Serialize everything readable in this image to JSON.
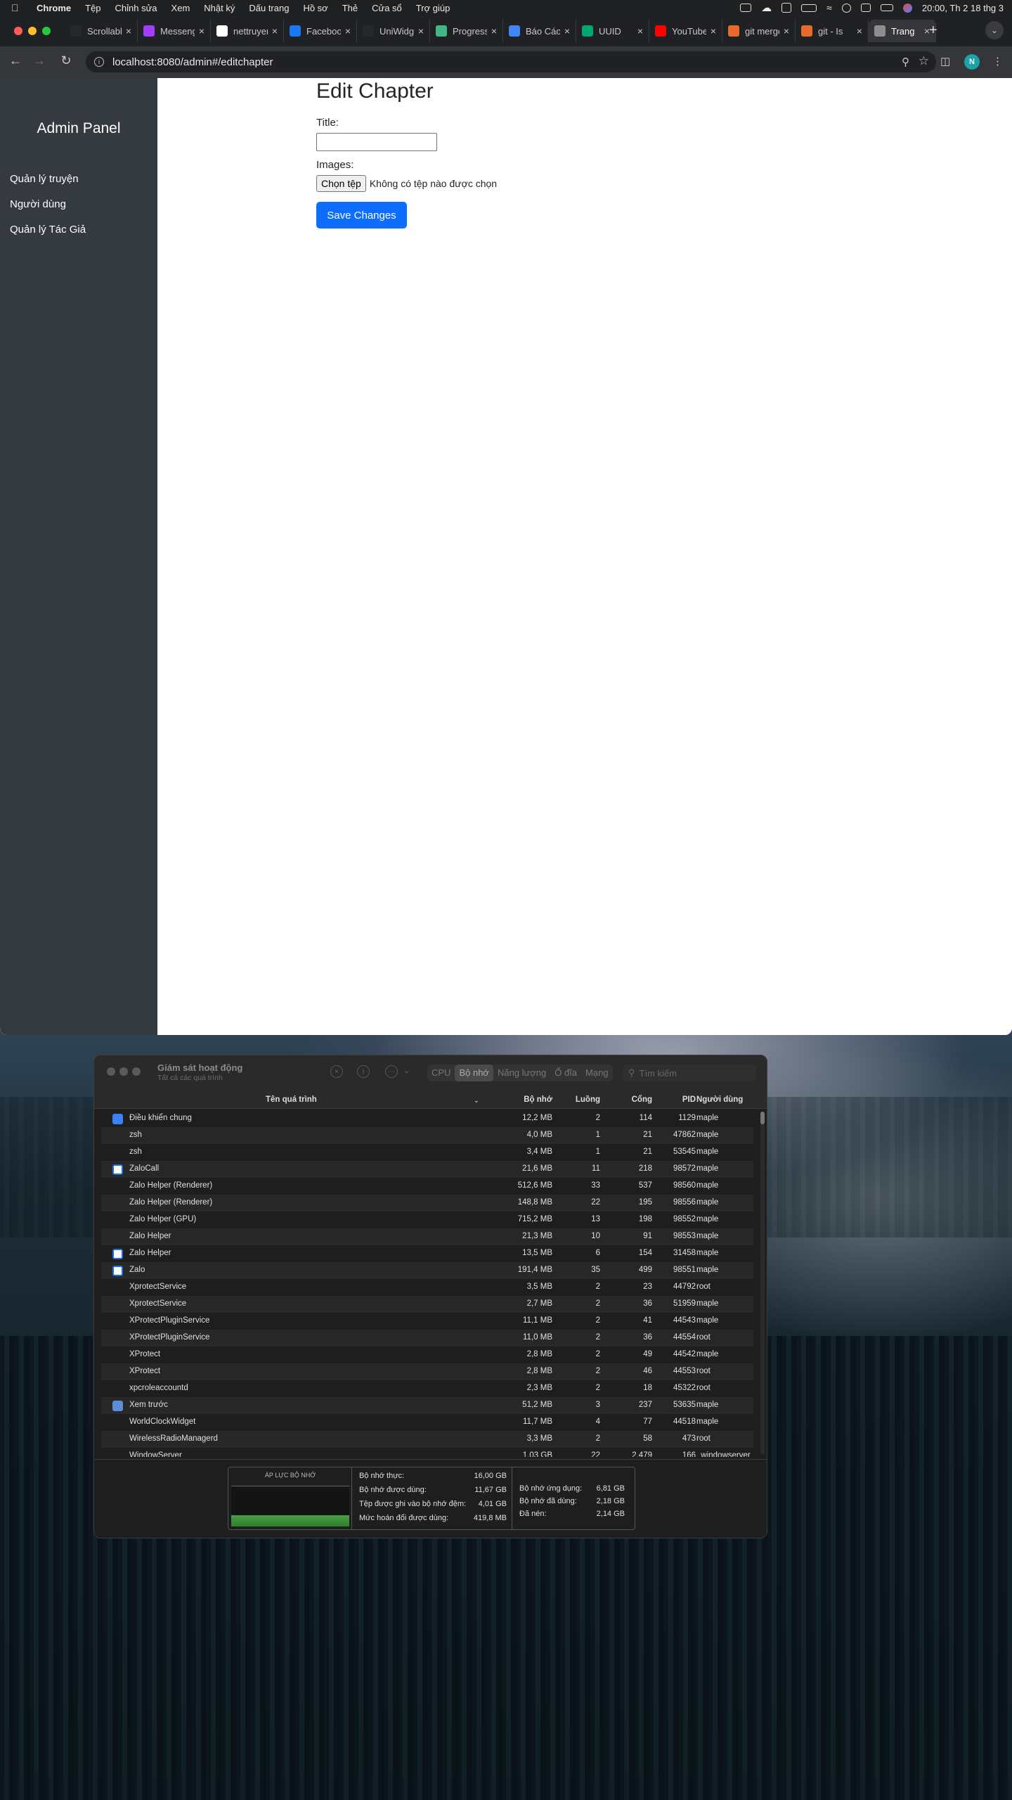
{
  "menubar": {
    "app": "Chrome",
    "items": [
      "Tệp",
      "Chỉnh sửa",
      "Xem",
      "Nhật ký",
      "Dấu trang",
      "Hồ sơ",
      "Thẻ",
      "Cửa sổ",
      "Trợ giúp"
    ],
    "clock": "20:00, Th 2 18 thg 3"
  },
  "browser": {
    "tabs": [
      {
        "label": "Scrollable",
        "icon": "github-icon",
        "color": "#24292e"
      },
      {
        "label": "Messenger",
        "icon": "messenger-icon",
        "color": "#a33dfc"
      },
      {
        "label": "nettruyen",
        "icon": "google-icon",
        "color": "#ffffff"
      },
      {
        "label": "Facebook",
        "icon": "facebook-icon",
        "color": "#1877f2"
      },
      {
        "label": "UniWidget",
        "icon": "github-icon",
        "color": "#24292e"
      },
      {
        "label": "Progress",
        "icon": "vue-icon",
        "color": "#41b883"
      },
      {
        "label": "Báo Cáo",
        "icon": "docs-icon",
        "color": "#4285f4"
      },
      {
        "label": "UUID",
        "icon": "leaf-icon",
        "color": "#00a86b"
      },
      {
        "label": "YouTube",
        "icon": "youtube-icon",
        "color": "#ff0000"
      },
      {
        "label": "git merge",
        "icon": "git-icon",
        "color": "#e56a2c"
      },
      {
        "label": "git - Is",
        "icon": "git-icon",
        "color": "#e56a2c"
      },
      {
        "label": "Trang",
        "icon": "globe-icon",
        "color": "#8e8e8e"
      }
    ],
    "url": "localhost:8080/admin#/editchapter",
    "profile_initial": "N"
  },
  "page": {
    "sidebar": {
      "brand": "Admin Panel",
      "items": [
        "Quản lý truyện",
        "Người dùng",
        "Quản lý Tác Giả"
      ]
    },
    "form": {
      "heading": "Edit Chapter",
      "title_label": "Title:",
      "title_value": "",
      "images_label": "Images:",
      "file_button": "Chọn tệp",
      "file_status": "Không có tệp nào được chọn",
      "save_button": "Save Changes"
    }
  },
  "activity_monitor": {
    "title": "Giám sát hoạt động",
    "subtitle": "Tất cả các quá trình",
    "tabs": [
      "CPU",
      "Bộ nhớ",
      "Năng lượng",
      "Ổ đĩa",
      "Mạng"
    ],
    "selected_tab": "Bộ nhớ",
    "search_placeholder": "Tìm kiếm",
    "columns": [
      "Tên quá trình",
      "Bộ nhớ",
      "Luồng",
      "Cổng",
      "PID",
      "Người dùng"
    ],
    "rows": [
      {
        "name": "Điều khiển chung",
        "mem": "12,2 MB",
        "threads": "2",
        "ports": "114",
        "pid": "1129",
        "user": "maple",
        "icon": "universal-control-icon"
      },
      {
        "name": "zsh",
        "mem": "4,0 MB",
        "threads": "1",
        "ports": "21",
        "pid": "47862",
        "user": "maple",
        "icon": ""
      },
      {
        "name": "zsh",
        "mem": "3,4 MB",
        "threads": "1",
        "ports": "21",
        "pid": "53545",
        "user": "maple",
        "icon": ""
      },
      {
        "name": "ZaloCall",
        "mem": "21,6 MB",
        "threads": "11",
        "ports": "218",
        "pid": "98572",
        "user": "maple",
        "icon": "zalo-icon"
      },
      {
        "name": "Zalo Helper (Renderer)",
        "mem": "512,6 MB",
        "threads": "33",
        "ports": "537",
        "pid": "98560",
        "user": "maple",
        "icon": ""
      },
      {
        "name": "Zalo Helper (Renderer)",
        "mem": "148,8 MB",
        "threads": "22",
        "ports": "195",
        "pid": "98556",
        "user": "maple",
        "icon": ""
      },
      {
        "name": "Zalo Helper (GPU)",
        "mem": "715,2 MB",
        "threads": "13",
        "ports": "198",
        "pid": "98552",
        "user": "maple",
        "icon": ""
      },
      {
        "name": "Zalo Helper",
        "mem": "21,3 MB",
        "threads": "10",
        "ports": "91",
        "pid": "98553",
        "user": "maple",
        "icon": ""
      },
      {
        "name": "Zalo Helper",
        "mem": "13,5 MB",
        "threads": "6",
        "ports": "154",
        "pid": "31458",
        "user": "maple",
        "icon": "zalo-icon"
      },
      {
        "name": "Zalo",
        "mem": "191,4 MB",
        "threads": "35",
        "ports": "499",
        "pid": "98551",
        "user": "maple",
        "icon": "zalo-icon"
      },
      {
        "name": "XprotectService",
        "mem": "3,5 MB",
        "threads": "2",
        "ports": "23",
        "pid": "44792",
        "user": "root",
        "icon": ""
      },
      {
        "name": "XprotectService",
        "mem": "2,7 MB",
        "threads": "2",
        "ports": "36",
        "pid": "51959",
        "user": "maple",
        "icon": ""
      },
      {
        "name": "XProtectPluginService",
        "mem": "11,1 MB",
        "threads": "2",
        "ports": "41",
        "pid": "44543",
        "user": "maple",
        "icon": ""
      },
      {
        "name": "XProtectPluginService",
        "mem": "11,0 MB",
        "threads": "2",
        "ports": "36",
        "pid": "44554",
        "user": "root",
        "icon": ""
      },
      {
        "name": "XProtect",
        "mem": "2,8 MB",
        "threads": "2",
        "ports": "49",
        "pid": "44542",
        "user": "maple",
        "icon": ""
      },
      {
        "name": "XProtect",
        "mem": "2,8 MB",
        "threads": "2",
        "ports": "46",
        "pid": "44553",
        "user": "root",
        "icon": ""
      },
      {
        "name": "xpcroleaccountd",
        "mem": "2,3 MB",
        "threads": "2",
        "ports": "18",
        "pid": "45322",
        "user": "root",
        "icon": ""
      },
      {
        "name": "Xem trước",
        "mem": "51,2 MB",
        "threads": "3",
        "ports": "237",
        "pid": "53635",
        "user": "maple",
        "icon": "preview-icon"
      },
      {
        "name": "WorldClockWidget",
        "mem": "11,7 MB",
        "threads": "4",
        "ports": "77",
        "pid": "44518",
        "user": "maple",
        "icon": ""
      },
      {
        "name": "WirelessRadioManagerd",
        "mem": "3,3 MB",
        "threads": "2",
        "ports": "58",
        "pid": "473",
        "user": "root",
        "icon": ""
      },
      {
        "name": "WindowServer",
        "mem": "1,03 GB",
        "threads": "22",
        "ports": "2.479",
        "pid": "166",
        "user": "_windowserver",
        "icon": ""
      }
    ],
    "memory_pressure_label": "ÁP LỰC BỘ NHỚ",
    "memory_pressure_level": 0.28,
    "stats_left": [
      {
        "label": "Bộ nhớ thực:",
        "value": "16,00 GB"
      },
      {
        "label": "Bộ nhớ được dùng:",
        "value": "11,67 GB"
      },
      {
        "label": "Tệp được ghi vào bộ nhớ đệm:",
        "value": "4,01 GB"
      },
      {
        "label": "Mức hoán đổi được dùng:",
        "value": "419,8 MB"
      }
    ],
    "stats_right": [
      {
        "label": "Bộ nhớ ứng dụng:",
        "value": "6,81 GB"
      },
      {
        "label": "Bộ nhớ đã dùng:",
        "value": "2,18 GB"
      },
      {
        "label": "Đã nén:",
        "value": "2,14 GB"
      }
    ]
  }
}
